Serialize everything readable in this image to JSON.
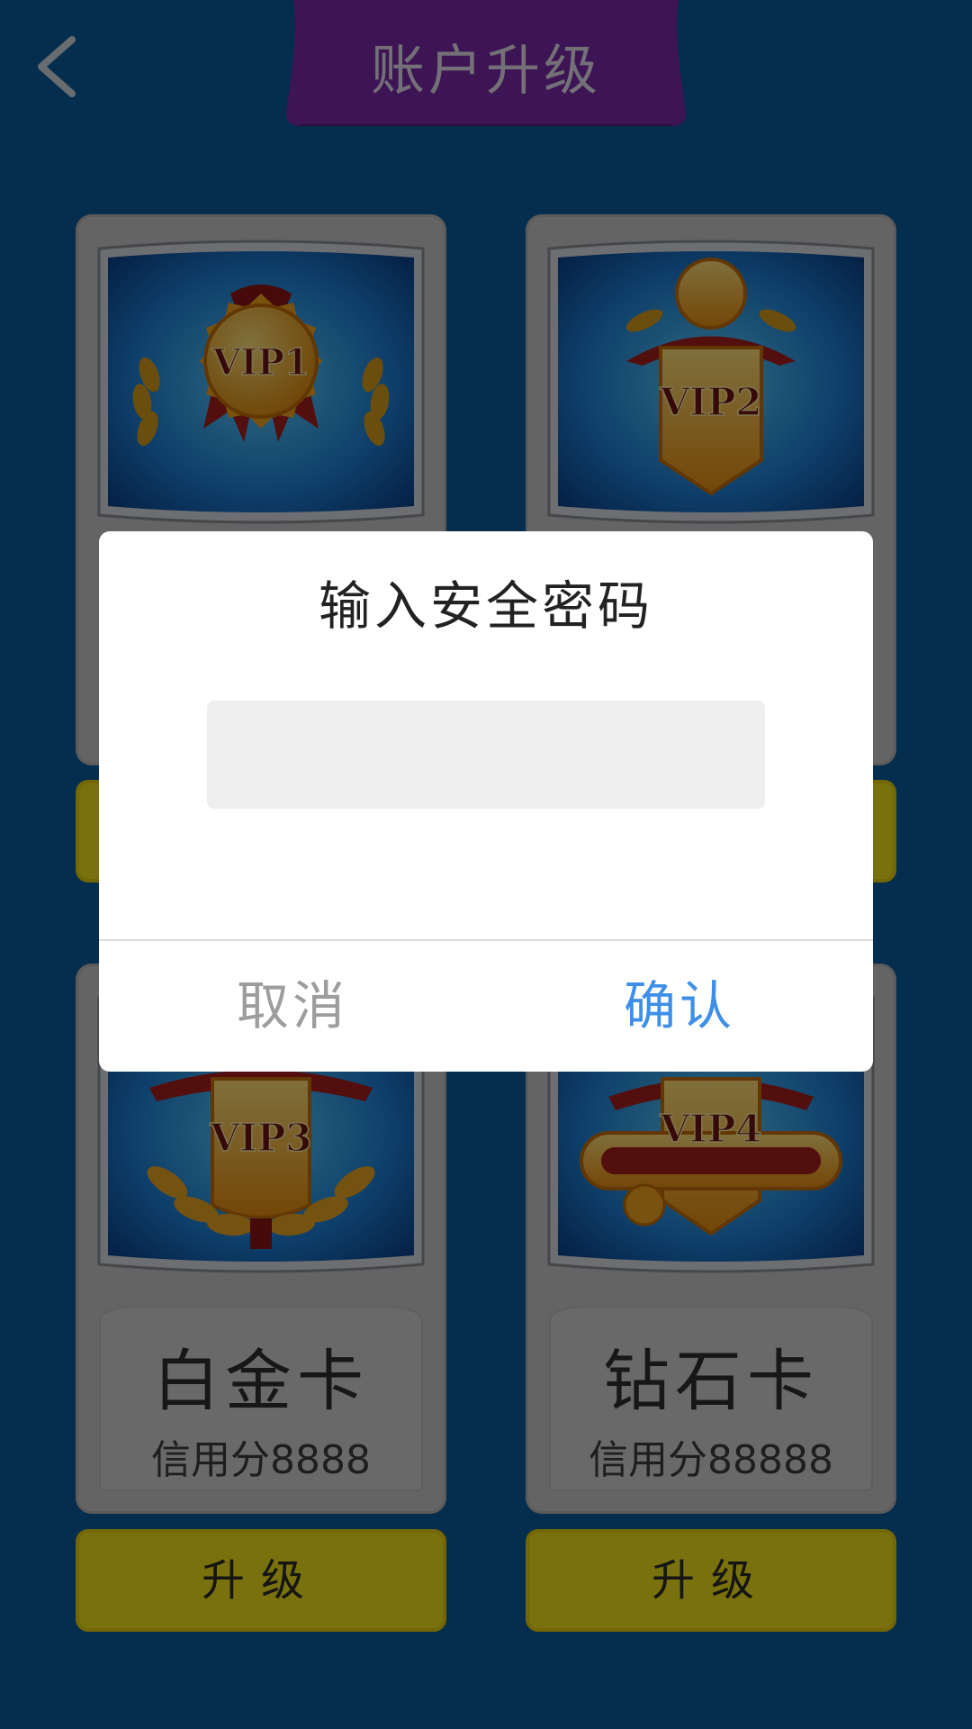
{
  "header": {
    "title": "账户升级",
    "back_icon": "chevron-left-icon"
  },
  "cards": [
    {
      "badge": "VIP1",
      "name": "",
      "credit": "",
      "button": ""
    },
    {
      "badge": "VIP2",
      "name": "",
      "credit": "",
      "button": ""
    },
    {
      "badge": "VIP3",
      "name": "白金卡",
      "credit": "信用分8888",
      "button": "升级"
    },
    {
      "badge": "VIP4",
      "name": "钻石卡",
      "credit": "信用分88888",
      "button": "升级"
    }
  ],
  "dialog": {
    "title": "输入安全密码",
    "input_value": "",
    "cancel_label": "取消",
    "confirm_label": "确认"
  },
  "colors": {
    "background": "#0b5a9a",
    "banner": "#7b2aa8",
    "upgrade_button": "#f2e21a",
    "confirm": "#3d8fe8",
    "cancel": "#9d9d9d"
  }
}
